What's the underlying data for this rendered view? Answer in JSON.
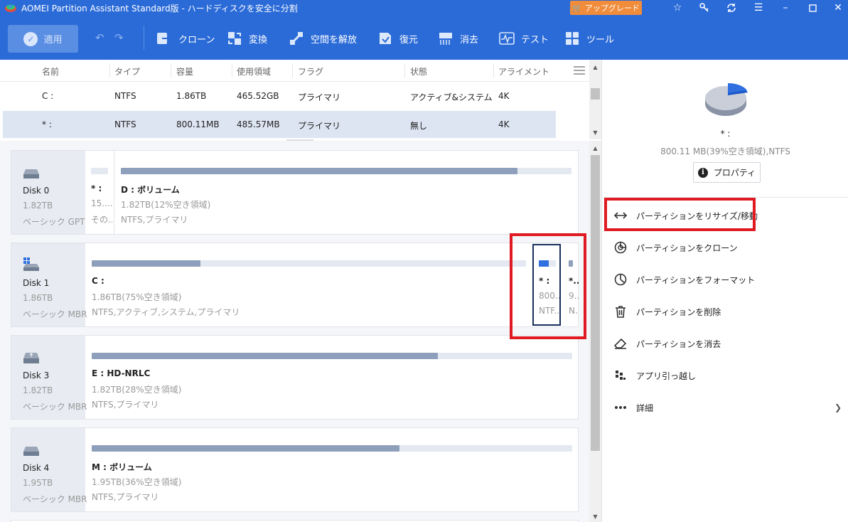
{
  "window": {
    "title": "AOMEI Partition Assistant Standard版 - ハードディスクを安全に分割",
    "upgrade_label": "アップグレード"
  },
  "toolbar": {
    "apply_label": "適用",
    "items": [
      {
        "label": "クローン",
        "icon": "clone-icon"
      },
      {
        "label": "変換",
        "icon": "convert-icon"
      },
      {
        "label": "空間を解放",
        "icon": "free-space-icon"
      },
      {
        "label": "復元",
        "icon": "recover-icon"
      },
      {
        "label": "消去",
        "icon": "wipe-icon"
      },
      {
        "label": "テスト",
        "icon": "test-icon"
      },
      {
        "label": "ツール",
        "icon": "tools-icon"
      }
    ]
  },
  "partition_table": {
    "columns": [
      "名前",
      "タイプ",
      "容量",
      "使用領域",
      "フラグ",
      "状態",
      "アライメント"
    ],
    "rows": [
      {
        "name": "C :",
        "type": "NTFS",
        "capacity": "1.86TB",
        "used": "465.52GB",
        "flag": "プライマリ",
        "status": "アクティブ&システム",
        "alignment": "4K"
      },
      {
        "name": "* :",
        "type": "NTFS",
        "capacity": "800.11MB",
        "used": "485.57MB",
        "flag": "プライマリ",
        "status": "無し",
        "alignment": "4K"
      }
    ],
    "selected_row": 1
  },
  "disks": [
    {
      "name": "Disk 0",
      "size": "1.82TB",
      "type": "ベーシック GPT",
      "partitions": [
        {
          "name": "* :",
          "line1": "15....",
          "line2": "その...",
          "fill": 0
        },
        {
          "name": "D : ボリューム",
          "line1": "1.82TB(12%空き領域)",
          "line2": "NTFS,プライマリ",
          "fill": 0.88
        }
      ]
    },
    {
      "name": "Disk 1",
      "size": "1.86TB",
      "type": "ベーシック MBR",
      "partitions": [
        {
          "name": "C :",
          "line1": "1.86TB(75%空き領域)",
          "line2": "NTFS,アクティブ,システム,プライマリ",
          "fill": 0.25
        },
        {
          "name": "* :",
          "line1": "800...",
          "line2": "NTF...",
          "fill": 0.6
        },
        {
          "name": "*...",
          "line1": "9...",
          "line2": "N...",
          "fill": 1
        }
      ]
    },
    {
      "name": "Disk 3",
      "size": "1.82TB",
      "type": "ベーシック MBR",
      "partitions": [
        {
          "name": "E : HD-NRLC",
          "line1": "1.82TB(28%空き領域)",
          "line2": "NTFS,プライマリ",
          "fill": 0.72
        }
      ]
    },
    {
      "name": "Disk 4",
      "size": "1.95TB",
      "type": "ベーシック MBR",
      "partitions": [
        {
          "name": "M : ボリューム",
          "line1": "1.95TB(36%空き領域)",
          "line2": "NTFS,プライマリ",
          "fill": 0.64
        }
      ]
    }
  ],
  "right_panel": {
    "selected_name": "* :",
    "selected_detail": "800.11 MB(39%空き領域),NTFS",
    "pie_free_fraction": 0.39,
    "properties_label": "プロパティ",
    "operations": [
      {
        "label": "パーティションをリサイズ/移動",
        "icon": "resize-move-icon"
      },
      {
        "label": "パーティションをクローン",
        "icon": "clone-partition-icon"
      },
      {
        "label": "パーティションをフォーマット",
        "icon": "format-icon"
      },
      {
        "label": "パーティションを削除",
        "icon": "trash-icon"
      },
      {
        "label": "パーティションを消去",
        "icon": "eraser-icon"
      },
      {
        "label": "アプリ引っ越し",
        "icon": "app-move-icon"
      },
      {
        "label": "詳細",
        "icon": "more-icon"
      }
    ]
  },
  "colors": {
    "brand_blue": "#2b6bd8",
    "upgrade_orange": "#f08c3a",
    "highlight_red": "#e01a22",
    "used_bar": "#8d9fba",
    "selected_used_bar": "#2f6fe0"
  }
}
